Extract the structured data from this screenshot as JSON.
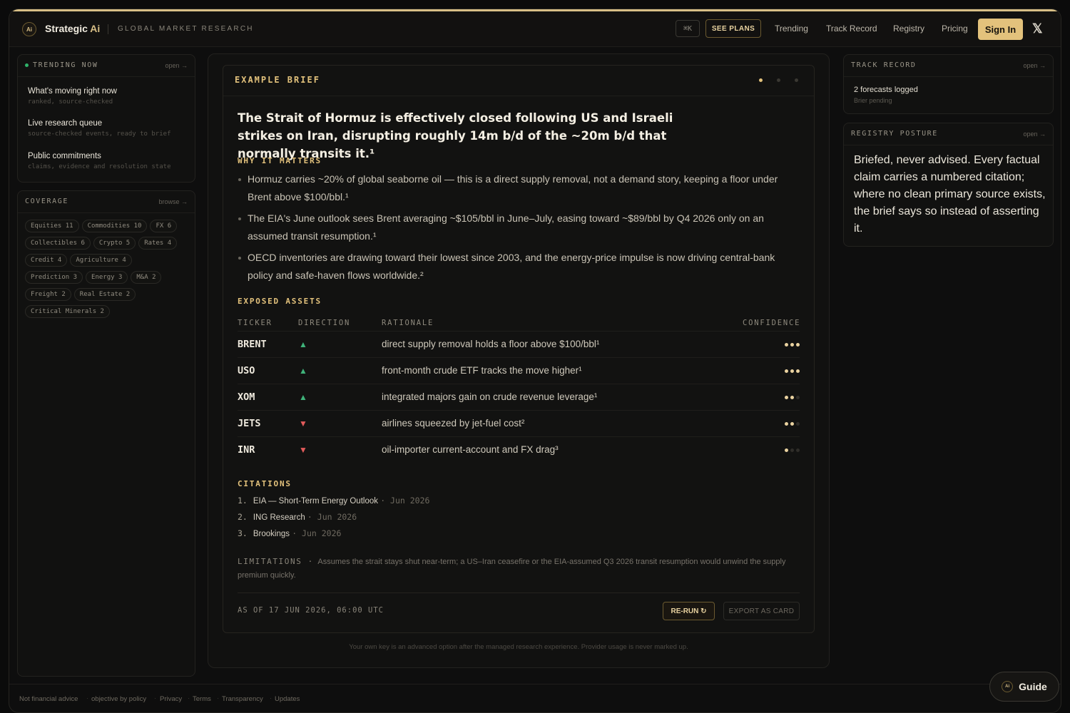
{
  "header": {
    "logo_text": "Ai",
    "brand_main": "Strategic",
    "brand_accent": "Ai",
    "tagline": "GLOBAL MARKET RESEARCH",
    "kbd": "⌘K",
    "see_plans": "SEE PLANS",
    "nav": [
      "Trending",
      "Track Record",
      "Registry",
      "Pricing"
    ],
    "sign_in": "Sign In",
    "x_icon": "𝕏"
  },
  "trending": {
    "title": "TRENDING NOW",
    "open": "open →",
    "items": [
      {
        "title": "What's moving right now",
        "sub": "ranked, source-checked"
      },
      {
        "title": "Live research queue",
        "sub": "source-checked events, ready to brief"
      },
      {
        "title": "Public commitments",
        "sub": "claims, evidence and resolution state"
      }
    ]
  },
  "coverage": {
    "title": "COVERAGE",
    "browse": "browse →",
    "chips": [
      "Equities 11",
      "Commodities 10",
      "FX 6",
      "Collectibles 6",
      "Crypto 5",
      "Rates 4",
      "Credit 4",
      "Agriculture 4",
      "Prediction 3",
      "Energy 3",
      "M&A 2",
      "Freight 2",
      "Real Estate 2",
      "Critical Minerals 2"
    ]
  },
  "brief": {
    "label": "EXAMPLE BRIEF",
    "headline": "The Strait of Hormuz is effectively closed following US and Israeli strikes on Iran, disrupting roughly 14m b/d of the ~20m b/d that normally transits it.¹",
    "why_title": "WHY IT MATTERS",
    "bullets": [
      "Hormuz carries ~20% of global seaborne oil — this is a direct supply removal, not a demand story, keeping a floor under Brent above $100/bbl.¹",
      "The EIA's June outlook sees Brent averaging ~$105/bbl in June–July, easing toward ~$89/bbl by Q4 2026 only on an assumed transit resumption.¹",
      "OECD inventories are drawing toward their lowest since 2003, and the energy-price impulse is now driving central-bank policy and safe-haven flows worldwide.²"
    ],
    "assets_title": "EXPOSED ASSETS",
    "table_headers": {
      "ticker": "TICKER",
      "direction": "DIRECTION",
      "rationale": "RATIONALE",
      "confidence": "CONFIDENCE"
    },
    "rows": [
      {
        "ticker": "BRENT",
        "dir": "▲",
        "rationale": "direct supply removal holds a floor above $100/bbl¹",
        "confidence": 3
      },
      {
        "ticker": "USO",
        "dir": "▲",
        "rationale": "front-month crude ETF tracks the move higher¹",
        "confidence": 3
      },
      {
        "ticker": "XOM",
        "dir": "▲",
        "rationale": "integrated majors gain on crude revenue leverage¹",
        "confidence": 2
      },
      {
        "ticker": "JETS",
        "dir": "▼",
        "rationale": "airlines squeezed by jet-fuel cost²",
        "confidence": 2
      },
      {
        "ticker": "INR",
        "dir": "▼",
        "rationale": "oil-importer current-account and FX drag³",
        "confidence": 1
      }
    ],
    "citations_title": "CITATIONS",
    "citations": [
      {
        "n": "1.",
        "source": "EIA — Short-Term Energy Outlook",
        "date": "· Jun 2026"
      },
      {
        "n": "2.",
        "source": "ING Research",
        "date": "· Jun 2026"
      },
      {
        "n": "3.",
        "source": "Brookings",
        "date": "· Jun 2026"
      }
    ],
    "limitations_label": "LIMITATIONS ·",
    "limitations": "Assumes the strait stays shut near-term; a US–Iran ceasefire or the EIA-assumed Q3 2026 transit resumption would unwind the supply premium quickly.",
    "as_of": "AS OF 17 JUN 2026, 06:00 UTC",
    "rerun": "RE-RUN ↻",
    "export": "EXPORT AS CARD"
  },
  "byok_note": "Your own key is an advanced option after the managed research experience. Provider usage is never marked up.",
  "track_record": {
    "title": "TRACK RECORD",
    "open": "open →",
    "count": "2 forecasts logged",
    "sub": "Brier pending"
  },
  "registry": {
    "title": "REGISTRY POSTURE",
    "open": "open →",
    "text": "Briefed, never advised. Every factual claim carries a numbered citation; where no clean primary source exists, the brief says so instead of asserting it."
  },
  "footer": {
    "links": [
      "Not financial advice",
      "objective by policy",
      "Privacy",
      "Terms",
      "Transparency",
      "Updates"
    ]
  },
  "guide": {
    "label": "Guide",
    "icon_text": "Ai"
  },
  "colors": {
    "accent": "#e3c27c",
    "up": "#3fb37a",
    "down": "#e25b5b",
    "background": "#0e0e0e"
  }
}
